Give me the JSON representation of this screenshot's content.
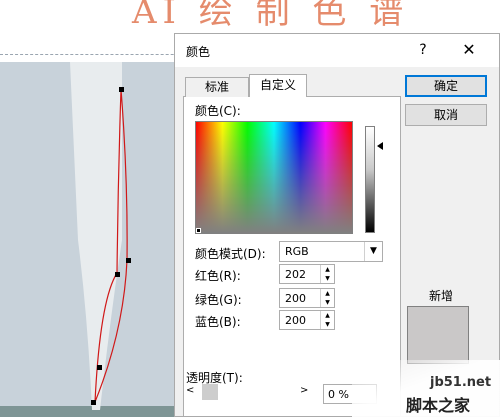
{
  "slide": {
    "title": "AI 绘 制 色 谱"
  },
  "dialog": {
    "title": "颜色",
    "help": "?",
    "close": "✕",
    "tabs": [
      "标准",
      "自定义"
    ],
    "ok_label": "确定",
    "cancel_label": "取消",
    "colors_label": "颜色(C):",
    "color_model_label": "颜色模式(D):",
    "color_model_value": "RGB",
    "red_label": "红色(R):",
    "red_value": "202",
    "green_label": "绿色(G):",
    "green_value": "200",
    "blue_label": "蓝色(B):",
    "blue_value": "200",
    "new_label": "新增",
    "new_color": "#cac8c8",
    "transparency_label": "透明度(T):",
    "transparency_value": "0 %"
  },
  "watermark": {
    "url": "jb51.net",
    "brand": "脚本之家"
  }
}
